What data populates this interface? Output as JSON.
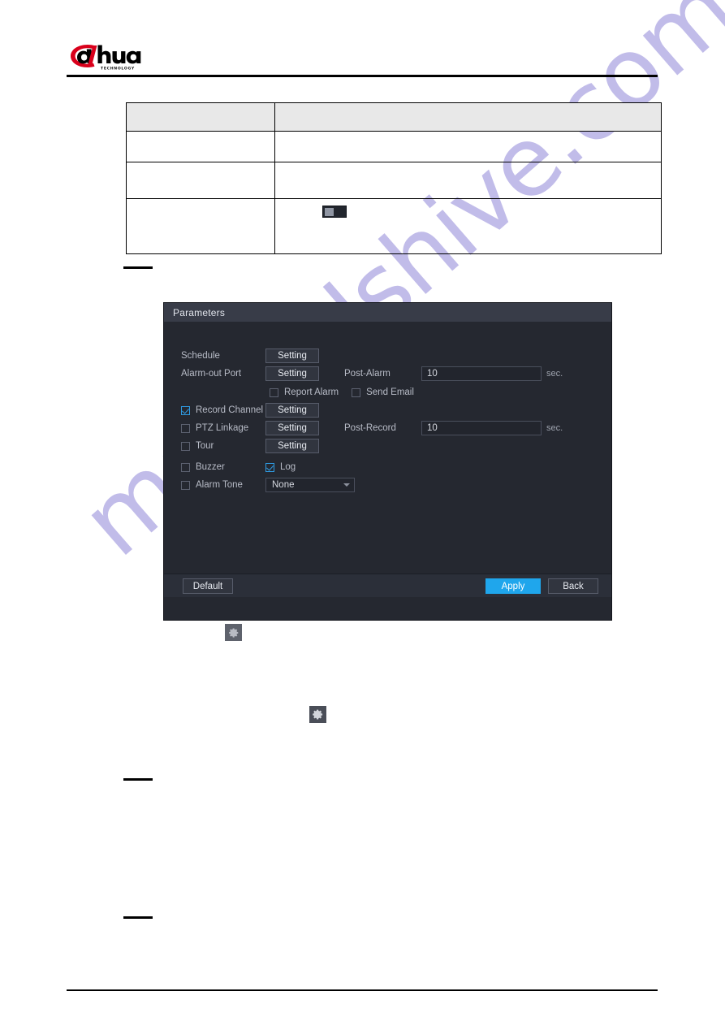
{
  "page": {
    "brand": "alhua",
    "brand_sub": "TECHNOLOGY",
    "watermark": "manualshive.com"
  },
  "spec_table": {
    "rows": [
      {
        "cells": [
          "",
          ""
        ]
      },
      {
        "cells": [
          "",
          ""
        ]
      },
      {
        "cells": [
          "",
          ""
        ]
      },
      {
        "cells": [
          "",
          ""
        ]
      }
    ],
    "thumbnail_icon": "image-thumbnail-icon"
  },
  "dialog": {
    "title": "Parameters",
    "rows": {
      "schedule": {
        "label": "Schedule",
        "button": "Setting"
      },
      "alarm_out_port": {
        "label": "Alarm-out Port",
        "button": "Setting"
      },
      "post_alarm": {
        "label": "Post-Alarm",
        "value": "10",
        "unit": "sec."
      },
      "report_alarm": {
        "label": "Report Alarm",
        "checked": false
      },
      "send_email": {
        "label": "Send Email",
        "checked": false
      },
      "record_channel": {
        "label": "Record Channel",
        "button": "Setting",
        "checked": true
      },
      "ptz_linkage": {
        "label": "PTZ Linkage",
        "button": "Setting",
        "checked": false
      },
      "post_record": {
        "label": "Post-Record",
        "value": "10",
        "unit": "sec."
      },
      "tour": {
        "label": "Tour",
        "button": "Setting",
        "checked": false
      },
      "buzzer": {
        "label": "Buzzer",
        "checked": false
      },
      "log": {
        "label": "Log",
        "checked": true
      },
      "alarm_tone": {
        "label": "Alarm Tone",
        "checked": false,
        "selected": "None"
      }
    },
    "footer": {
      "default_label": "Default",
      "apply_label": "Apply",
      "back_label": "Back"
    },
    "colors": {
      "accent": "#1fa6ec",
      "checkbox_checked": "#2f9ae0",
      "panel_bg": "#252830",
      "titlebar_bg": "#383c48"
    }
  },
  "icons": {
    "gear_upper": "gear-icon",
    "gear_lower": "gear-icon"
  }
}
